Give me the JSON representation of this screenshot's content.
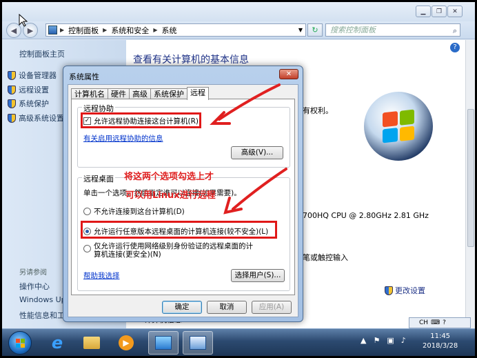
{
  "window": {
    "address": [
      "控制面板",
      "系统和安全",
      "系统"
    ],
    "search_placeholder": "搜索控制面板"
  },
  "left_pane": {
    "home": "控制面板主页",
    "items": [
      {
        "label": "设备管理器"
      },
      {
        "label": "远程设置"
      },
      {
        "label": "系统保护"
      },
      {
        "label": "高级系统设置"
      }
    ],
    "see_also": "另请参阅",
    "links": [
      "操作中心",
      "Windows Update",
      "性能信息和工具"
    ]
  },
  "main_pane": {
    "title": "查看有关计算机的基本信息",
    "rights_text": "有权利。",
    "cpu_text": "700HQ CPU @ 2.80GHz   2.81 GHz",
    "touch_text": "笔或触控输入",
    "change_settings": "更改设置",
    "bottom_label": "计算机信息"
  },
  "dialog": {
    "title": "系统属性",
    "close": "✕",
    "tabs": [
      "计算机名",
      "硬件",
      "高级",
      "系统保护",
      "远程"
    ],
    "active_tab": "远程",
    "remote_assist": {
      "group_label": "远程协助",
      "checkbox_label": "允许远程协助连接这台计算机(R)",
      "checked": true,
      "link": "有关启用远程协助的信息",
      "advanced_btn": "高级(V)..."
    },
    "remote_desktop": {
      "group_label": "远程桌面",
      "instruction": "单击一个选项，然后指定谁可以连接(如果需要)。",
      "options": [
        {
          "label": "不允许连接到这台计算机(D)",
          "selected": false
        },
        {
          "label": "允许运行任意版本远程桌面的计算机连接(较不安全)(L)",
          "selected": true
        },
        {
          "label": "仅允许运行使用网络级别身份验证的远程桌面的计算机连接(更安全)(N)",
          "selected": false
        }
      ],
      "help_link": "帮助我选择",
      "select_users_btn": "选择用户(S)..."
    },
    "ok_btn": "确定",
    "cancel_btn": "取消",
    "apply_btn": "应用(A)"
  },
  "annotation": {
    "line1": "将这两个选项勾选上才",
    "line2": "可以用Linux进行远程",
    "color": "#e02020"
  },
  "taskbar": {
    "lang": "CH",
    "time": "11:45",
    "date": "2018/3/28"
  }
}
